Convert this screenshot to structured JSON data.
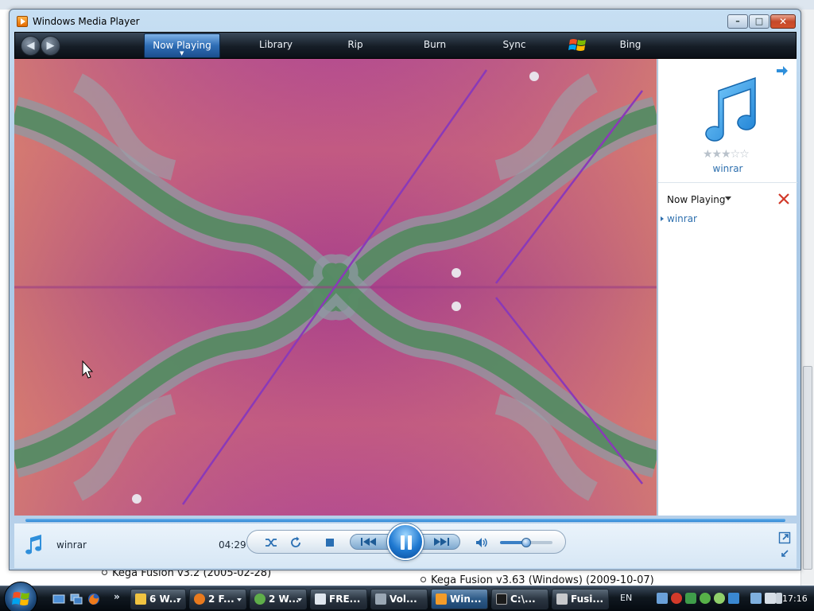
{
  "window": {
    "title": "Windows Media Player",
    "minimize_glyph": "–",
    "maximize_glyph": "□",
    "close_glyph": "✕"
  },
  "nav": {
    "back_glyph": "◀",
    "forward_glyph": "▶",
    "tabs": [
      {
        "label": "Now Playing",
        "active": true
      },
      {
        "label": "Library"
      },
      {
        "label": "Rip"
      },
      {
        "label": "Burn"
      },
      {
        "label": "Sync"
      },
      {
        "label": "Bing"
      }
    ]
  },
  "list_pane": {
    "album_title": "winrar",
    "rating_stars": "★★★☆☆",
    "rating": 3,
    "list_header": "Now Playing",
    "items": [
      {
        "title": "winrar"
      }
    ]
  },
  "player": {
    "track_name": "winrar",
    "time_elapsed": "04:29",
    "volume_fraction": 0.5
  },
  "background_page": {
    "items": [
      "Kega Fusion v3.2 (2005-02-28)",
      "Kega Fusion v3.63 (Windows) (2009-10-07)"
    ]
  },
  "taskbar": {
    "quicklaunch_more": "»",
    "buttons": [
      {
        "label": "6 W...",
        "icon": "folder-icon",
        "has_menu": true
      },
      {
        "label": "2 F...",
        "icon": "firefox-icon",
        "has_menu": true
      },
      {
        "label": "2 W...",
        "icon": "messenger-icon",
        "has_menu": true
      },
      {
        "label": "FRE...",
        "icon": "document-icon",
        "has_menu": false
      },
      {
        "label": "Vol...",
        "icon": "volume-icon",
        "has_menu": false
      },
      {
        "label": "Win...",
        "icon": "wmp-icon",
        "has_menu": false,
        "active": true
      },
      {
        "label": "C:\\...",
        "icon": "7zip-icon",
        "has_menu": false
      },
      {
        "label": "Fusi...",
        "icon": "kega-icon",
        "has_menu": false
      }
    ],
    "language": "EN",
    "clock": "17:16"
  },
  "colors": {
    "accent": "#2d6fae",
    "nav_dark": "#151d26",
    "visual_magenta": "#b24f8a"
  }
}
